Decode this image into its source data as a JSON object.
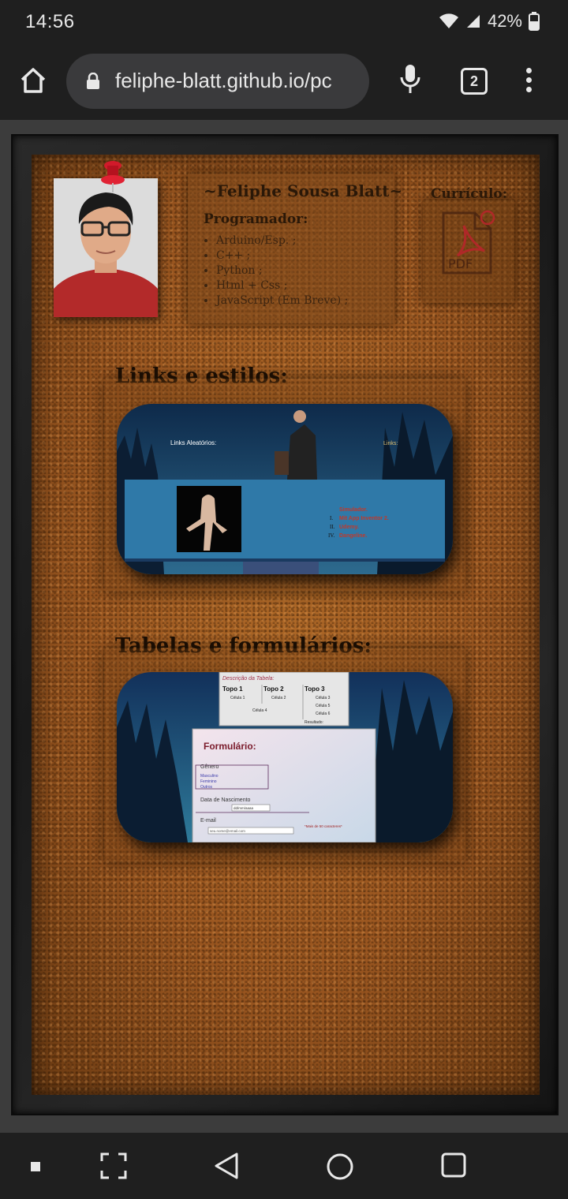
{
  "status": {
    "time": "14:56",
    "battery": "42%"
  },
  "browser": {
    "url": "feliphe-blatt.github.io/pc",
    "tab_count": "2"
  },
  "profile": {
    "name": "~Feliphe Sousa Blatt~",
    "role": "Programador:",
    "skills": [
      "Arduino/Esp. ;",
      "C++ ;",
      "Python ;",
      "Html + Css ;",
      "JavaScript (Em Breve) ;"
    ]
  },
  "cv": {
    "label": "Currículo:",
    "pdf_text": "PDF"
  },
  "links_section": {
    "title": "Links e estilos:",
    "preview": {
      "left_label": "Links Aleatórios:",
      "right_label": "Links:",
      "list": [
        {
          "marker": "",
          "text": "Simulador."
        },
        {
          "marker": "I.",
          "text": "Mit App Inventor 2."
        },
        {
          "marker": "II.",
          "text": "Udemy."
        },
        {
          "marker": "IV.",
          "text": "Dangeline."
        }
      ]
    }
  },
  "tables_section": {
    "title": "Tabelas e formulários:",
    "table": {
      "caption": "Descrição da Tabela:",
      "headers": [
        "Topo 1",
        "Topo 2",
        "Topo 3"
      ],
      "cells": [
        "Célula 1",
        "Célula 2",
        "Célula 3",
        "Célula 4",
        "Célula 5",
        "Célula 6"
      ],
      "footer": "Resultado:"
    },
    "form": {
      "title": "Formulário:",
      "gender_legend": "Gênero",
      "gender_options": [
        "Masculino",
        "Feminino",
        "Outros"
      ],
      "birth_legend": "Data de Nascimento",
      "date_placeholder": "dd/mm/aaaa",
      "email_legend": "E-mail",
      "email_placeholder": "seu.nome@email.com",
      "note": "*Mais de 50 caracteres*"
    }
  },
  "colors": {
    "cork": "#9a5a1f",
    "link_red": "#c0392b",
    "dark_text": "#1a0e04"
  }
}
